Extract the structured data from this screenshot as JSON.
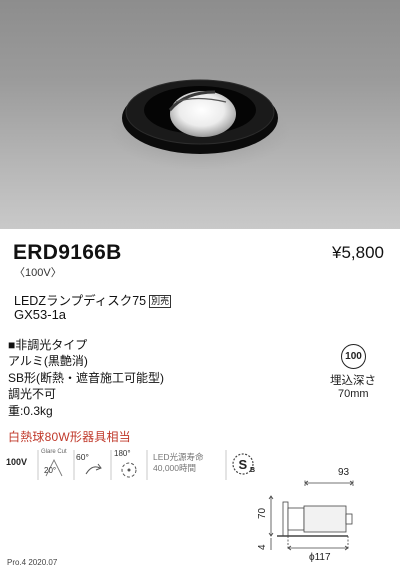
{
  "product": {
    "model": "ERD9166B",
    "voltage_note": "〈100V〉",
    "price": "¥5,800",
    "lamp_text": "LEDZランプディスク75",
    "sold_separately": "別売",
    "socket": "GX53-1a"
  },
  "specs": [
    "■非調光タイプ",
    "アルミ(黒艶消)",
    "SB形(断熱・遮音施工可能型)",
    "調光不可",
    "重:0.3kg"
  ],
  "embed": {
    "badge": "100",
    "label": "埋込深さ",
    "value": "70mm"
  },
  "equivalent": "白熱球80W形器具相当",
  "icons": {
    "voltage": "100V",
    "glare_cut_label": "Glare Cut",
    "glare_cut_angle": "20°",
    "tilt": "60°",
    "rotation": "180°",
    "led_life_label": "LED光源寿命",
    "led_life_value": "40,000時間",
    "sb_mark": "S",
    "sb_sub": "B"
  },
  "dimensions": {
    "top": "93",
    "left": "70",
    "left_small": "4",
    "bottom": "ϕ117"
  },
  "footer": "Pro.4 2020.07",
  "colors": {
    "fixture_black": "#0a0a0a",
    "accent_red": "#c0392b",
    "photo_bg": "#a6a6a6"
  }
}
